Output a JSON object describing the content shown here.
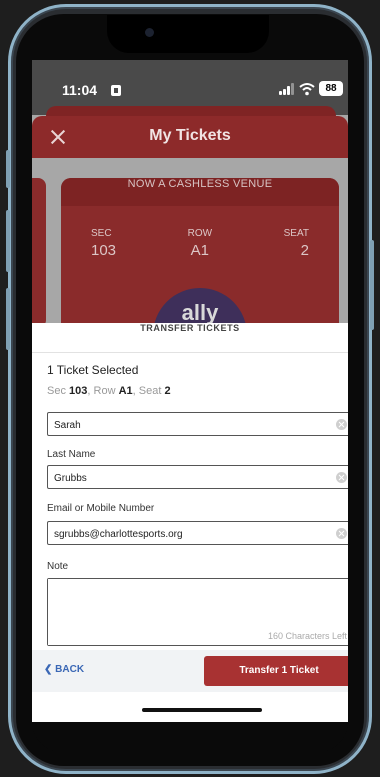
{
  "status_bar": {
    "time": "11:04",
    "battery": "88"
  },
  "header": {
    "title": "My Tickets"
  },
  "ticket": {
    "banner": "NOW A CASHLESS VENUE",
    "section_label": "SEC",
    "section": "103",
    "row_label": "ROW",
    "row": "A1",
    "seat_label": "SEAT",
    "seat": "2",
    "sponsor": "ally"
  },
  "transfer": {
    "title": "TRANSFER TICKETS",
    "selected": "1 Ticket Selected",
    "seat_summary": {
      "sec_label": "Sec",
      "sec": "103",
      "row_label": "Row",
      "row": "A1",
      "seat_label": "Seat",
      "seat": "2"
    },
    "first_name_value": "Sarah",
    "last_name_label": "Last Name",
    "last_name_value": "Grubbs",
    "contact_label": "Email or Mobile Number",
    "contact_value": "sgrubbs@charlottesports.org",
    "note_label": "Note",
    "note_value": "",
    "char_count": "160 Characters Left",
    "back_label": "BACK",
    "submit_label": "Transfer 1 Ticket"
  },
  "colors": {
    "accent_red": "#a83232",
    "header_red": "#8d2a2a",
    "link_blue": "#3a67b5"
  }
}
